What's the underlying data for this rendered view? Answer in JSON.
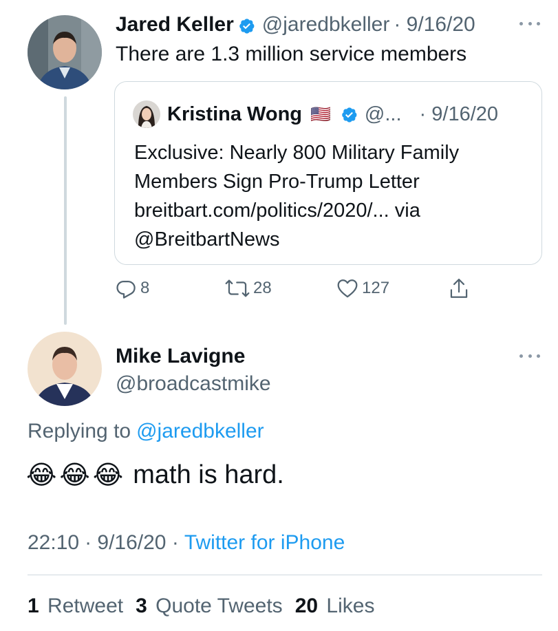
{
  "tweet1": {
    "author_name": "Jared Keller",
    "handle": "@jaredbkeller",
    "date": "· 9/16/20",
    "text": "There are 1.3 million service members",
    "quote": {
      "author_name": "Kristina Wong",
      "flag": "🇺🇸",
      "handle": "@...",
      "date": "· 9/16/20",
      "text": "Exclusive: Nearly 800 Military Family Members Sign Pro-Trump Letter breitbart.com/politics/2020/... via @BreitbartNews"
    },
    "actions": {
      "replies": "8",
      "retweets": "28",
      "likes": "127"
    }
  },
  "tweet2": {
    "author_name": "Mike Lavigne",
    "handle": "@broadcastmike",
    "replying_prefix": "Replying to",
    "replying_to": "@jaredbkeller",
    "emojis": "😂😂😂",
    "text": "math is hard.",
    "time": "22:10",
    "date": "· 9/16/20 ·",
    "source": "Twitter for iPhone"
  },
  "stats": {
    "retweets_count": "1",
    "retweets_label": "Retweet",
    "quotes_count": "3",
    "quotes_label": "Quote Tweets",
    "likes_count": "20",
    "likes_label": "Likes"
  },
  "colors": {
    "accent": "#1d9bf0",
    "muted": "#536471",
    "border": "#cfd9de"
  },
  "icons": [
    "verified-badge-icon",
    "more-icon",
    "reply-icon",
    "retweet-icon",
    "like-icon",
    "share-icon"
  ]
}
